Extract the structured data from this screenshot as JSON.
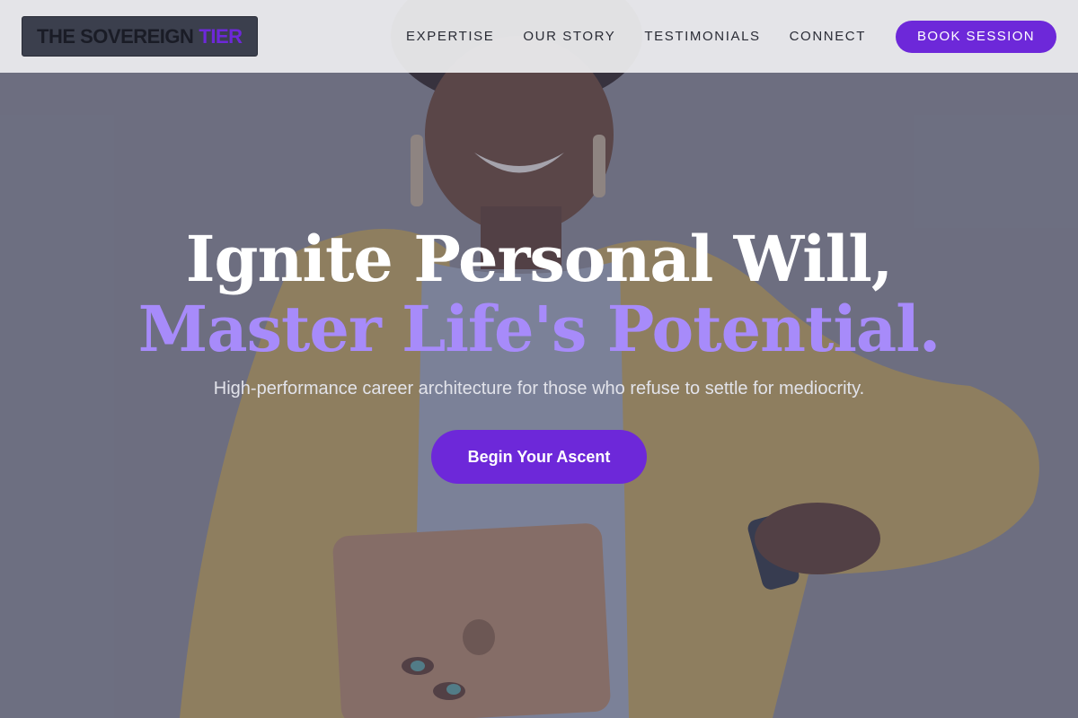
{
  "brand": {
    "name_primary": "THE SOVEREIGN",
    "name_accent": "TIER"
  },
  "nav": {
    "links": [
      {
        "label": "EXPERTISE"
      },
      {
        "label": "OUR STORY"
      },
      {
        "label": "TESTIMONIALS"
      },
      {
        "label": "CONNECT"
      }
    ],
    "cta_label": "BOOK SESSION"
  },
  "hero": {
    "headline_line1": "Ignite Personal Will,",
    "headline_line2": "Master Life's Potential.",
    "subtitle": "High-performance career architecture for those who refuse to settle for mediocrity.",
    "cta_label": "Begin Your Ascent",
    "background_image": "smiling-woman-holding-tablet"
  },
  "colors": {
    "accent": "#6d28d9",
    "headline_accent": "#a78bfa",
    "nav_background": "#ececee"
  }
}
